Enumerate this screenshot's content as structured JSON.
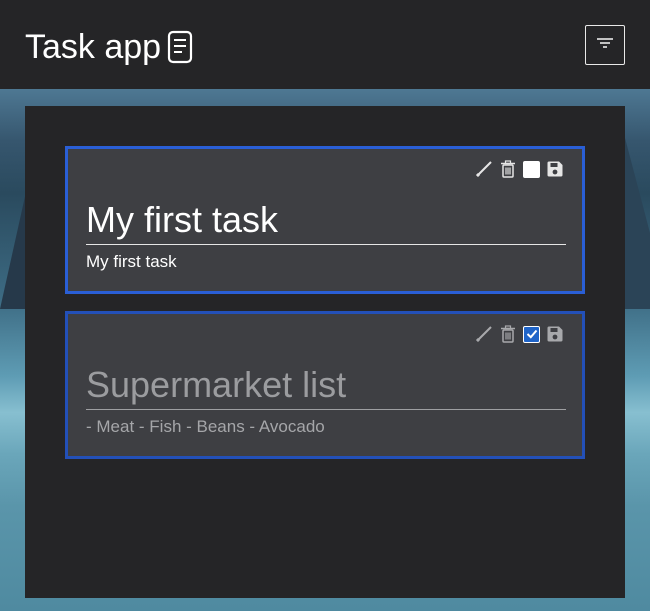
{
  "header": {
    "title": "Task app",
    "title_icon": "document-icon",
    "menu_icon": "filter-lines-icon"
  },
  "tasks": [
    {
      "title": "My first task",
      "description": "My first task",
      "completed": false,
      "actions": [
        "edit-icon",
        "trash-icon",
        "checkbox",
        "save-icon"
      ]
    },
    {
      "title": "Supermarket list",
      "description": "- Meat - Fish - Beans - Avocado",
      "completed": true,
      "actions": [
        "edit-icon",
        "trash-icon",
        "checkbox",
        "save-icon"
      ]
    }
  ],
  "colors": {
    "background": "#252527",
    "card": "#3e3f43",
    "active_border": "#2a5fd6",
    "done_border": "#2350b8",
    "checkbox_checked": "#1f64c8",
    "muted_text": "#9b9c9f"
  }
}
